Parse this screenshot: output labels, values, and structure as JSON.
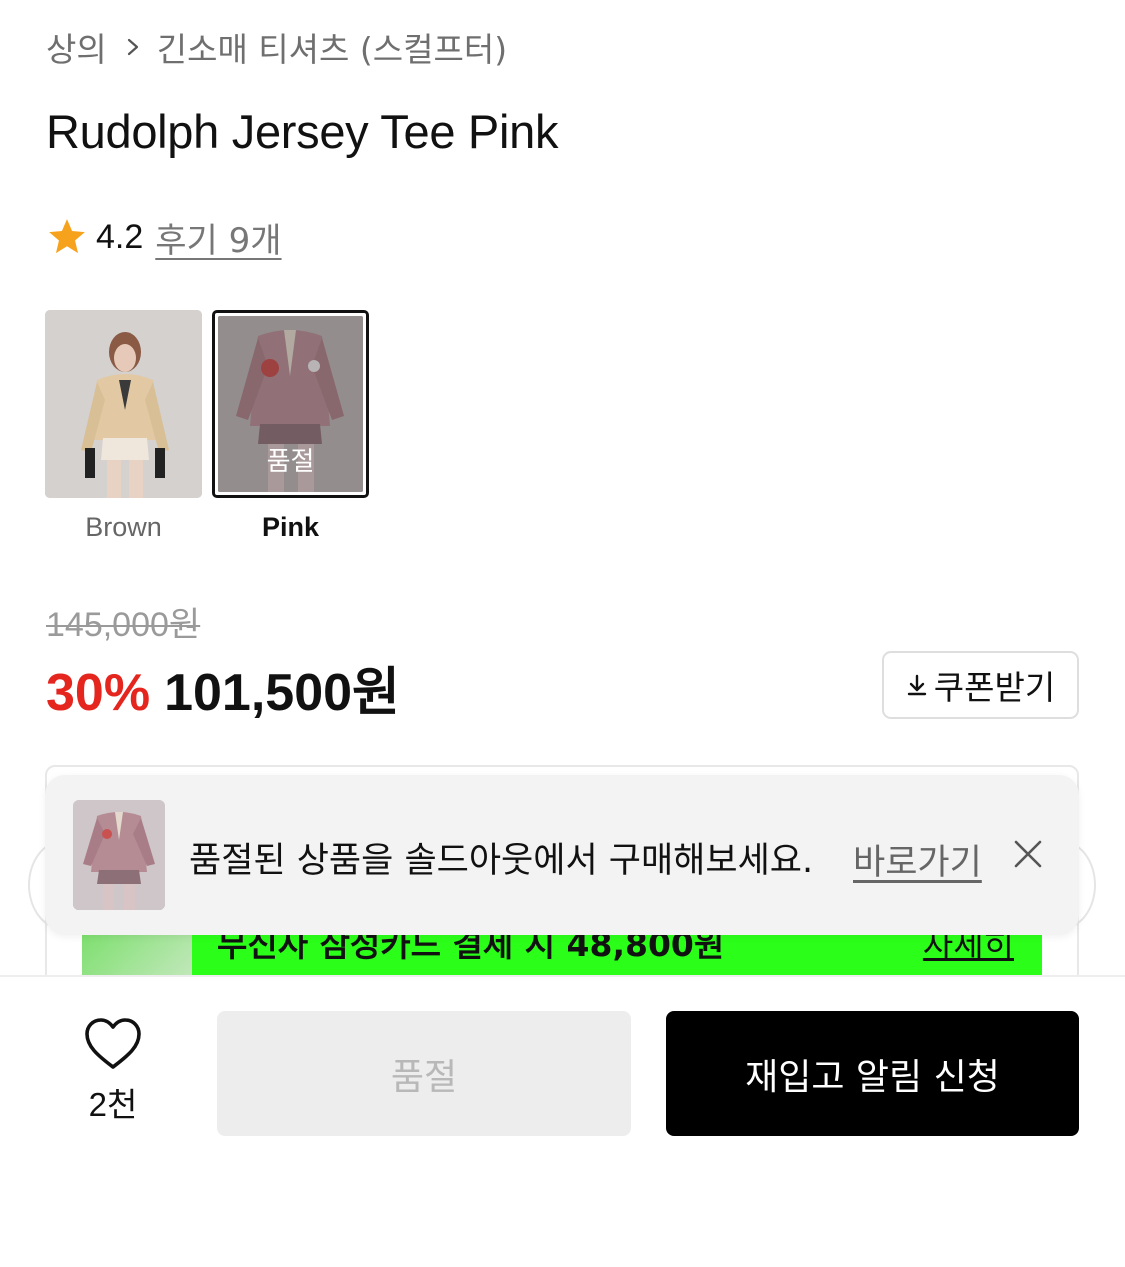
{
  "breadcrumb": {
    "category": "상의",
    "subcategory": "긴소매 티셔츠 (스컬프터)"
  },
  "product": {
    "title": "Rudolph Jersey Tee Pink",
    "rating": "4.2",
    "reviews_label": "후기 9개"
  },
  "colors": {
    "options": [
      {
        "label": "Brown",
        "selected": false,
        "sold_out": false
      },
      {
        "label": "Pink",
        "selected": true,
        "sold_out": true,
        "badge": "품절"
      }
    ]
  },
  "price": {
    "original": "145,000원",
    "discount": "30%",
    "final": "101,500원",
    "coupon_label": "쿠폰받기"
  },
  "promo": {
    "text": "무신사 삼성카드 결제 시 48,800원",
    "more": "자세히"
  },
  "toast": {
    "message": "품절된 상품을 솔드아웃에서 구매해보세요.",
    "link": "바로가기"
  },
  "bottom": {
    "like_count": "2천",
    "soldout_label": "품절",
    "restock_label": "재입고 알림 신청"
  },
  "theme": {
    "accent_red": "#e5261f",
    "star": "#f7a21c",
    "promo_green": "#2bff19"
  }
}
